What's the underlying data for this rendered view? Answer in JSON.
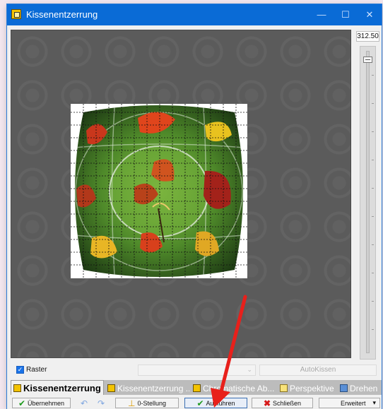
{
  "window": {
    "title": "Kissenentzerrung",
    "minimize": "—",
    "maximize": "☐",
    "close": "✕"
  },
  "zoom": {
    "value": "312.50",
    "level": 0.98
  },
  "raster": {
    "label": "Raster",
    "checked": true,
    "check": "✓"
  },
  "combo": {
    "value": "",
    "arrow": "⌄"
  },
  "autokissen": {
    "label": "AutoKissen"
  },
  "tabs": [
    {
      "label": "Kissenentzerrung",
      "active": true,
      "icon": "frame-icon"
    },
    {
      "label": "Kissenentzerrung ...",
      "active": false,
      "icon": "frame-icon"
    },
    {
      "label": "Chromatische Ab...",
      "active": false,
      "icon": "frame-icon"
    },
    {
      "label": "Perspektive",
      "active": false,
      "icon": "page-icon"
    },
    {
      "label": "Drehen",
      "active": false,
      "icon": "rotate-icon"
    }
  ],
  "toolbar": {
    "apply_label": "Übernehmen",
    "reset_label": "0-Stellung",
    "run_label": "Ausführen",
    "close_label": "Schließen",
    "extended_label": "Erweitert",
    "extended_arrow": "▾",
    "check_icon": "✔",
    "x_icon": "✖",
    "undo_icon": "↶",
    "redo_icon": "↷"
  },
  "colors": {
    "titlebar": "#0a6bd6",
    "canvas": "#5b5b5b",
    "annotation_arrow": "#e8201b"
  }
}
